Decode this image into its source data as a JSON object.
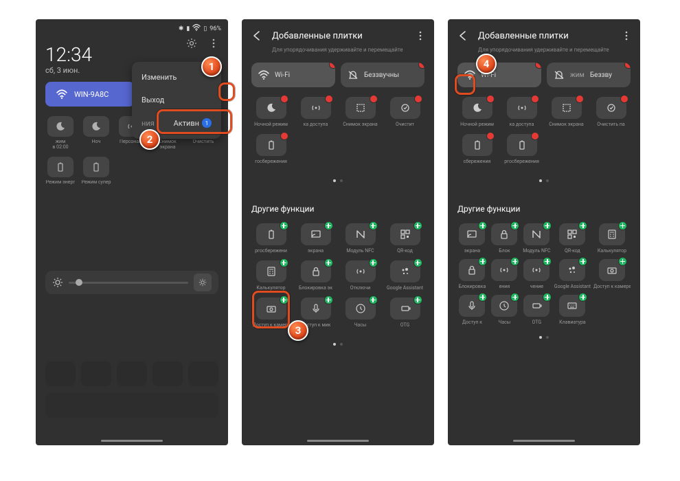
{
  "markers": {
    "m1": "1",
    "m2": "2",
    "m3": "3",
    "m4": "4"
  },
  "phone1": {
    "status": {
      "battery": "96%"
    },
    "time": "12:34",
    "date": "сб, 3 июн.",
    "wifi_label": "WIN-9A8C",
    "menu": {
      "edit": "Изменить",
      "exit": "Выход",
      "notif": "ния",
      "active": "Активн",
      "badge": "1"
    },
    "tiles": {
      "t0": "жим",
      "t0b": "в 02:00",
      "t1": "Ноч",
      "t2": "Персональ",
      "t3": "Снимок",
      "t3b": "экрана",
      "t4": "Очистить",
      "t5": "Режим энерг",
      "t6": "Режим супер"
    }
  },
  "phone2": {
    "title": "Добавленные плитки",
    "subtitle": "Для упорядочивания удерживайте и перемещайте",
    "wifi": "Wi-Fi",
    "dnd": "Беззвучны",
    "r2": {
      "t0": "Ночной режим",
      "t1": "ка доступа",
      "t2": "Снимок экрана",
      "t3": "Очистит"
    },
    "r3": {
      "t0": "госбережения"
    },
    "section2": "Другие функции",
    "other": {
      "t0": "ргосбережени",
      "t1": "экрана",
      "t2": "Модуль NFC",
      "t3": "QR-код",
      "t4": "Калькулятор",
      "t5": "Блокировка эк",
      "t6": "Отключи",
      "t7": "Google Assistant",
      "t8": "Доступ к камере",
      "t9": "Доступ к мик",
      "t10": "Часы",
      "t11": "OTG"
    }
  },
  "phone3": {
    "title": "Добавленные плитки",
    "subtitle": "Для упорядочивания удерживайте и перемещайте",
    "wifi": "Wi-Fi",
    "dnd_pre": "жим",
    "dnd": "Беззву",
    "r2": {
      "t0": "Ночной режим",
      "t1": "ка доступа",
      "t2": "Снимок экрана",
      "t3": "Очистить па"
    },
    "r3": {
      "t0": "сбережения",
      "t1": "ргосбережения"
    },
    "section2": "Другие функции",
    "other": {
      "t0": "экрана",
      "t1": "Блок",
      "t2": "Модуль NFC",
      "t3": "QR-код",
      "t4": "Калькулятор",
      "t5": "Блокировка",
      "t6": "ения",
      "t7": "чение",
      "t8": "Google Assistant",
      "t9": "Доступ к камере",
      "t10": "Доступ к",
      "t11": "Часы",
      "t12": "OTG",
      "t13": "Клавиатура"
    }
  }
}
